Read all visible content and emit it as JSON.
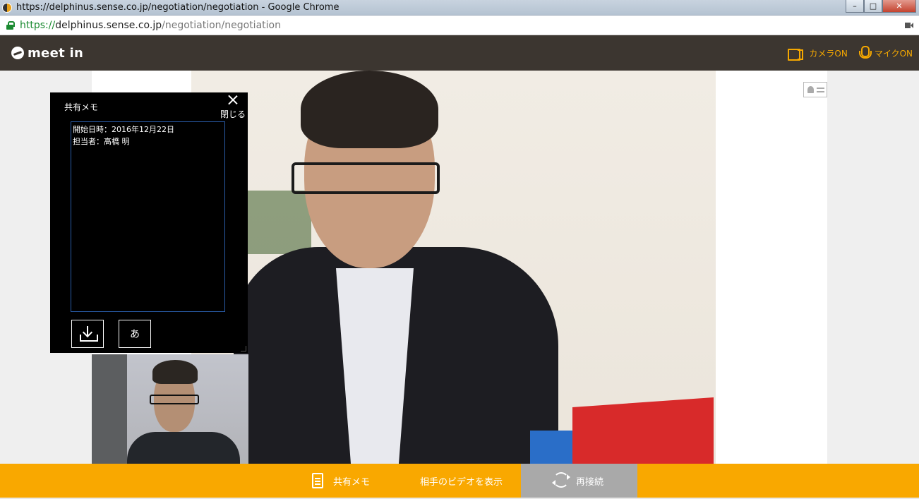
{
  "browser": {
    "window_title": "https://delphinus.sense.co.jp/negotiation/negotiation - Google Chrome",
    "url_scheme": "https://",
    "url_host": "delphinus.sense.co.jp",
    "url_path": "/negotiation/negotiation"
  },
  "header": {
    "logo_text": "meet in",
    "camera_label": "カメラON",
    "mic_label": "マイクON"
  },
  "memo": {
    "title": "共有メモ",
    "close_label": "閉じる",
    "text": "開始日時：2016年12月22日\n担当者：高橋 明",
    "ime_label": "あ"
  },
  "bottombar": {
    "memo_label": "共有メモ",
    "show_video_label": "相手のビデオを表示",
    "reconnect_label": "再接続"
  },
  "colors": {
    "header_bg": "#3c3630",
    "accent": "#f9a800",
    "reconnect_bg": "#a9a9a9"
  }
}
